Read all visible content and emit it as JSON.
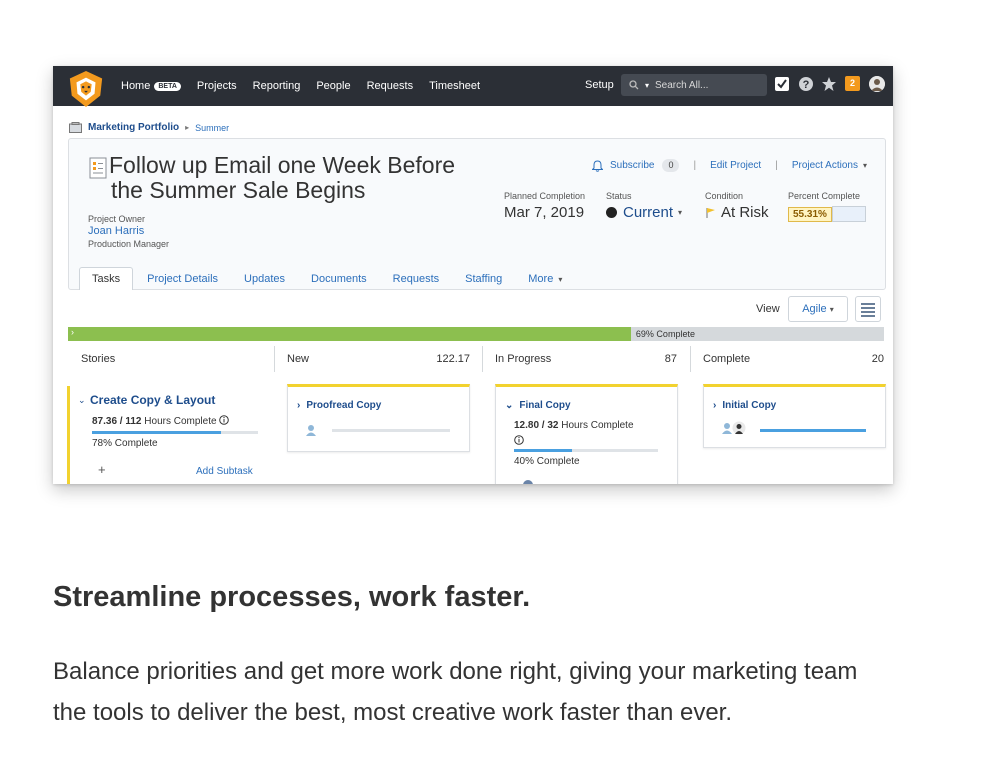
{
  "nav": {
    "items": [
      "Home",
      "Projects",
      "Reporting",
      "People",
      "Requests",
      "Timesheet"
    ],
    "beta_badge": "BETA",
    "setup": "Setup",
    "search_placeholder": "Search All...",
    "notification_count": "2"
  },
  "breadcrumb": {
    "portfolio": "Marketing Portfolio",
    "program": "Summer"
  },
  "project": {
    "title_line1": "Follow up Email one Week Before",
    "title_line2": "the Summer Sale Begins",
    "owner_label": "Project Owner",
    "owner_name": "Joan Harris",
    "owner_role": "Production Manager",
    "subscribe": "Subscribe",
    "subscriber_count": "0",
    "edit_project": "Edit Project",
    "project_actions": "Project Actions",
    "planned_completion_label": "Planned Completion",
    "planned_completion": "Mar 7, 2019",
    "status_label": "Status",
    "status": "Current",
    "condition_label": "Condition",
    "condition": "At Risk",
    "percent_complete_label": "Percent Complete",
    "percent_complete": "55.31%"
  },
  "tabs": [
    "Tasks",
    "Project Details",
    "Updates",
    "Documents",
    "Requests",
    "Staffing",
    "More"
  ],
  "view": {
    "label": "View",
    "selected": "Agile"
  },
  "progress": {
    "value": 69,
    "label": "69% Complete"
  },
  "board": {
    "columns": [
      {
        "name": "Stories",
        "total": ""
      },
      {
        "name": "New",
        "total": "122.17"
      },
      {
        "name": "In Progress",
        "total": "87"
      },
      {
        "name": "Complete",
        "total": "20"
      }
    ],
    "story": {
      "title": "Create Copy & Layout",
      "hours_done": "87.36 / 112",
      "hours_suffix": "Hours Complete",
      "percent": "78% Complete",
      "percent_value": 78,
      "plus": "+",
      "add_subtask": "Add Subtask"
    },
    "tasks": {
      "new": {
        "title": "Proofread Copy",
        "progress": 0
      },
      "in_progress": {
        "title": "Final Copy",
        "hours_done": "12.80 / 32",
        "hours_suffix": "Hours Complete",
        "percent": "40% Complete",
        "percent_value": 40
      },
      "complete": {
        "title": "Initial Copy",
        "progress": 100
      }
    }
  },
  "marketing": {
    "headline": "Streamline processes, work faster.",
    "paragraph": "Balance priorities and get more work done right, giving your marketing team the tools to deliver the best, most creative work faster than ever."
  },
  "colors": {
    "topbar": "#2b2f36",
    "accent_blue": "#2c6fbb",
    "progress_green": "#8cbf4f",
    "story_yellow": "#f2d22e",
    "logo_orange": "#f39a1e"
  }
}
